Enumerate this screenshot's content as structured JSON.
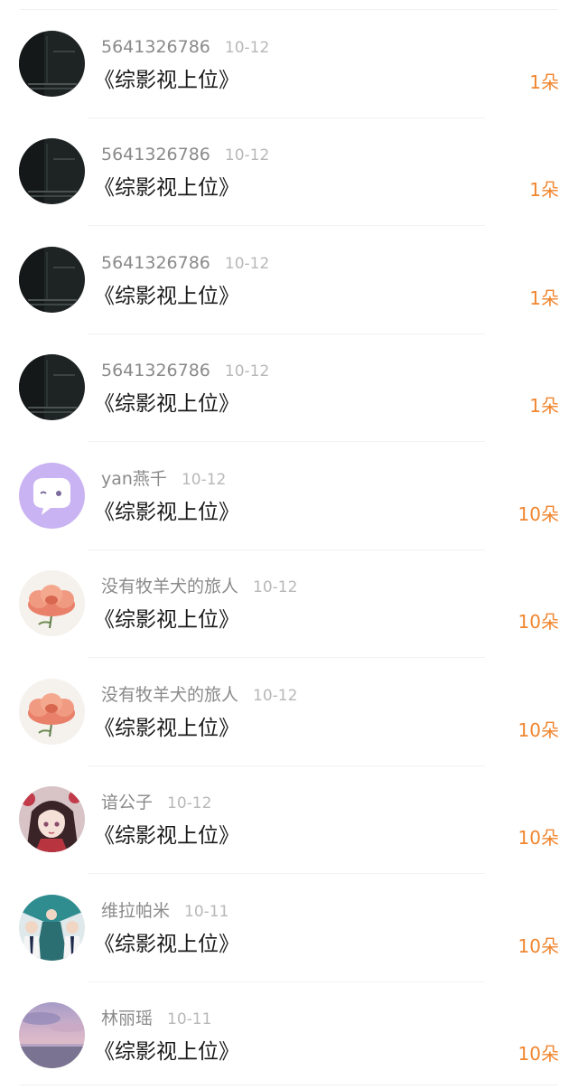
{
  "gift_list": [
    {
      "user": "5641326786",
      "date": "10-12",
      "work": "《综影视上位》",
      "gift": "1朵",
      "avatar": "dark-photo-avatar"
    },
    {
      "user": "5641326786",
      "date": "10-12",
      "work": "《综影视上位》",
      "gift": "1朵",
      "avatar": "dark-photo-avatar"
    },
    {
      "user": "5641326786",
      "date": "10-12",
      "work": "《综影视上位》",
      "gift": "1朵",
      "avatar": "dark-photo-avatar"
    },
    {
      "user": "5641326786",
      "date": "10-12",
      "work": "《综影视上位》",
      "gift": "1朵",
      "avatar": "dark-photo-avatar"
    },
    {
      "user": "yan燕千",
      "date": "10-12",
      "work": "《综影视上位》",
      "gift": "10朵",
      "avatar": "chat-bubble-avatar"
    },
    {
      "user": "没有牧羊犬的旅人",
      "date": "10-12",
      "work": "《综影视上位》",
      "gift": "10朵",
      "avatar": "peony-flower-avatar"
    },
    {
      "user": "没有牧羊犬的旅人",
      "date": "10-12",
      "work": "《综影视上位》",
      "gift": "10朵",
      "avatar": "peony-flower-avatar"
    },
    {
      "user": "谙公子",
      "date": "10-12",
      "work": "《综影视上位》",
      "gift": "10朵",
      "avatar": "anime-girl-avatar"
    },
    {
      "user": "维拉帕米",
      "date": "10-11",
      "work": "《综影视上位》",
      "gift": "10朵",
      "avatar": "group-photo-avatar"
    },
    {
      "user": "林丽瑶",
      "date": "10-11",
      "work": "《综影视上位》",
      "gift": "10朵",
      "avatar": "sunset-sky-avatar"
    }
  ],
  "colors": {
    "gift_accent": "#f0862f",
    "name_gray": "#8a8a8a",
    "date_gray": "#b8b8b8",
    "work_text": "#1a1a1a"
  }
}
